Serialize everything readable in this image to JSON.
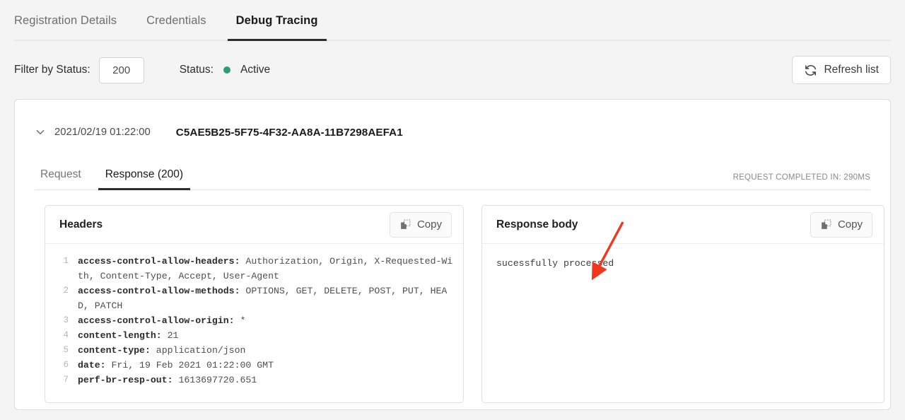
{
  "tabs": [
    {
      "label": "Registration Details",
      "active": false
    },
    {
      "label": "Credentials",
      "active": false
    },
    {
      "label": "Debug Tracing",
      "active": true
    }
  ],
  "filter": {
    "label": "Filter by Status:",
    "value": "200",
    "placeholder": "200"
  },
  "status": {
    "label": "Status:",
    "value": "Active",
    "dot_color": "#2d9d78"
  },
  "refresh": {
    "label": "Refresh list",
    "icon": "refresh-icon"
  },
  "entry": {
    "chevron": "chevron-down-icon",
    "date": "2021/02/19 01:22:00",
    "id": "C5AE5B25-5F75-4F32-AA8A-11B7298AEFA1"
  },
  "inner_tabs": [
    {
      "label": "Request",
      "active": false
    },
    {
      "label": "Response (200)",
      "active": true
    }
  ],
  "completed_note": "REQUEST COMPLETED IN: 290MS",
  "headers_panel": {
    "title": "Headers",
    "copy_label": "Copy",
    "copy_icon": "copy-icon",
    "lines": [
      {
        "n": "1",
        "key": "access-control-allow-headers:",
        "value": " Authorization, Origin, X-Requested-With, Content-Type, Accept, User-Agent"
      },
      {
        "n": "2",
        "key": "access-control-allow-methods:",
        "value": " OPTIONS, GET, DELETE, POST, PUT, HEAD, PATCH"
      },
      {
        "n": "3",
        "key": "access-control-allow-origin:",
        "value": " *"
      },
      {
        "n": "4",
        "key": "content-length:",
        "value": " 21"
      },
      {
        "n": "5",
        "key": "content-type:",
        "value": " application/json"
      },
      {
        "n": "6",
        "key": "date:",
        "value": " Fri, 19 Feb 2021 01:22:00 GMT"
      },
      {
        "n": "7",
        "key": "perf-br-resp-out:",
        "value": " 1613697720.651"
      }
    ]
  },
  "body_panel": {
    "title": "Response body",
    "copy_label": "Copy",
    "copy_icon": "copy-icon",
    "content": "sucessfully processed"
  },
  "annotation": {
    "type": "arrow",
    "color": "#f4341c"
  }
}
